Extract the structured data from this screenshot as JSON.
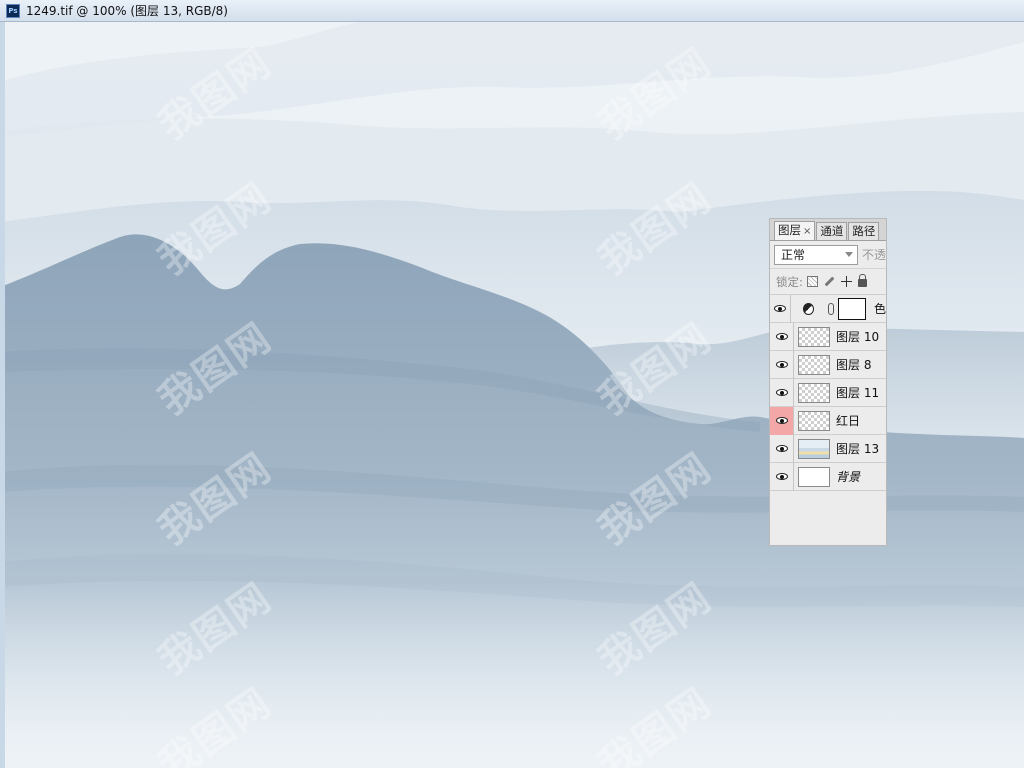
{
  "window": {
    "title": "1249.tif @ 100% (图层 13, RGB/8)",
    "app_icon": "photoshop-icon"
  },
  "canvas": {
    "watermark_text": "我图网"
  },
  "layers_panel": {
    "tabs": [
      {
        "label": "图层",
        "close": "×"
      },
      {
        "label": "通道"
      },
      {
        "label": "路径"
      }
    ],
    "blend_mode": "正常",
    "opacity_label": "不透",
    "lock_label": "锁定:",
    "adjustment_tail": "色",
    "layers": [
      {
        "name": "图层 10",
        "visible": true,
        "thumb": "transparent"
      },
      {
        "name": "图层 8",
        "visible": true,
        "thumb": "transparent"
      },
      {
        "name": "图层 11",
        "visible": true,
        "thumb": "transparent"
      },
      {
        "name": "红日",
        "visible": true,
        "thumb": "transparent",
        "highlighted": true
      },
      {
        "name": "图层 13",
        "visible": true,
        "thumb": "landscape"
      },
      {
        "name": "背景",
        "visible": true,
        "thumb": "white",
        "italic": true
      }
    ]
  },
  "colors": {
    "sky": "#e7eef4",
    "far_mountain": "#c9d6e1",
    "mid_mountain": "#a9bccd",
    "near_mountain": "#93a9be",
    "highlight_eye": "#f4a7a7"
  }
}
